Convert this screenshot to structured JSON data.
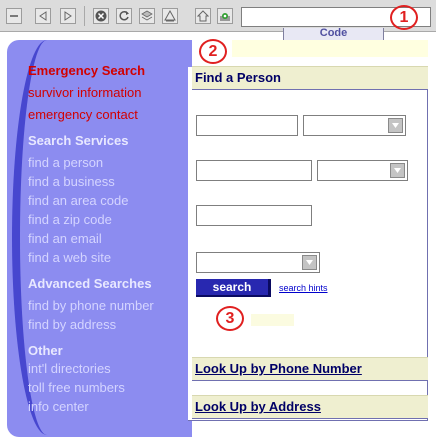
{
  "toolbar": {
    "buttons": [
      {
        "name": "minimize",
        "glyph": "–"
      },
      {
        "name": "back",
        "glyph": ""
      },
      {
        "name": "forward",
        "glyph": ""
      },
      {
        "name": "stop",
        "glyph": "×"
      },
      {
        "name": "reload",
        "glyph": ""
      },
      {
        "name": "bookmarks",
        "glyph": ""
      },
      {
        "name": "print",
        "glyph": ""
      },
      {
        "name": "home",
        "glyph": ""
      },
      {
        "name": "security",
        "glyph": ""
      }
    ],
    "address_value": ""
  },
  "markers": [
    "1",
    "2",
    "3"
  ],
  "top_tab": {
    "label": "Code"
  },
  "sidebar": {
    "emergency_title": "Emergency Search",
    "emergency_links": [
      "survivor information",
      "emergency contact"
    ],
    "search_services": {
      "title": "Search Services",
      "items": [
        "find a person",
        "find a business",
        "find an area code",
        "find a zip code",
        "find an email",
        "find a web site"
      ]
    },
    "advanced_searches": {
      "title": "Advanced Searches",
      "items": [
        "find by phone number",
        "find by address"
      ]
    },
    "other": {
      "title": "Other",
      "items": [
        "int'l directories",
        "toll free numbers",
        "info center"
      ]
    }
  },
  "main": {
    "find_person_header": "Find a Person",
    "search_button": "search",
    "search_hints_link": "search hints",
    "phone_header": "Look Up by Phone Number",
    "address_header": "Look Up by Address",
    "fields": {
      "row1_text": "",
      "row2_text": "",
      "row3_text": "",
      "row1_select": "",
      "row2_select": "",
      "row4_select": ""
    }
  },
  "colors": {
    "sidebar": "#8c8cf0",
    "emergency_red": "#d20000",
    "search_button": "#2828b0",
    "header_bg": "#efefd0",
    "marker_red": "#e02020"
  }
}
